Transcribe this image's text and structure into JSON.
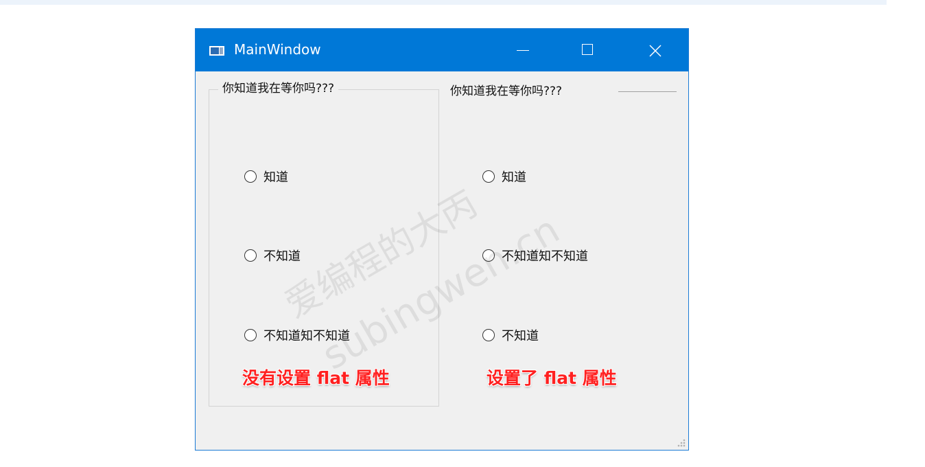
{
  "window": {
    "title": "MainWindow",
    "titlebar_color": "#0078d7",
    "icons": {
      "app": "app-window-icon",
      "minimize": "minimize-icon",
      "maximize": "maximize-icon",
      "close": "close-icon"
    }
  },
  "group_left": {
    "title": "你知道我在等你吗???",
    "flat": false,
    "options": [
      {
        "label": "知道",
        "checked": false
      },
      {
        "label": "不知道",
        "checked": false
      },
      {
        "label": "不知道知不知道",
        "checked": false
      }
    ],
    "annotation": "没有设置 flat 属性"
  },
  "group_right": {
    "title": "你知道我在等你吗???",
    "flat": true,
    "options": [
      {
        "label": "知道",
        "checked": false
      },
      {
        "label": "不知道知不知道",
        "checked": false
      },
      {
        "label": "不知道",
        "checked": false
      }
    ],
    "annotation": "设置了 flat 属性"
  },
  "watermark": {
    "line1": "爱编程的大丙",
    "line2": "subingwen.cn"
  },
  "colors": {
    "annotation": "#ff2020",
    "window_bg": "#f0f0f0"
  }
}
